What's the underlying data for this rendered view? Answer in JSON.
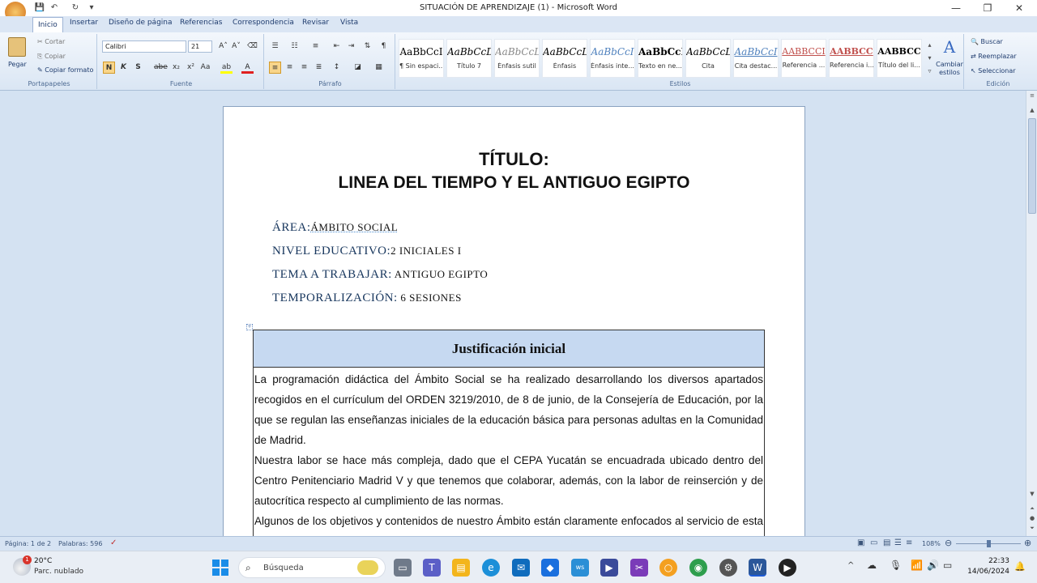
{
  "window": {
    "title": "SITUACIÓN DE APRENDIZAJE (1) - Microsoft Word",
    "minimize": "—",
    "restore": "❐",
    "close": "✕"
  },
  "tabs": [
    "Inicio",
    "Insertar",
    "Diseño de página",
    "Referencias",
    "Correspondencia",
    "Revisar",
    "Vista"
  ],
  "ribbon": {
    "clipboard": {
      "paste": "Pegar",
      "cut": "Cortar",
      "copy": "Copiar",
      "format_painter": "Copiar formato",
      "group": "Portapapeles"
    },
    "font": {
      "name": "Calibri",
      "size": "21",
      "group": "Fuente",
      "bold": "N",
      "italic": "K",
      "underline": "S"
    },
    "paragraph": {
      "group": "Párrafo"
    },
    "styles": {
      "group": "Estilos",
      "items": [
        {
          "sample": "AaBbCcI",
          "name": "¶ Sin espaci..."
        },
        {
          "sample": "AaBbCcD",
          "name": "Título 7"
        },
        {
          "sample": "AaBbCcL",
          "name": "Énfasis sutil"
        },
        {
          "sample": "AaBbCcL",
          "name": "Énfasis"
        },
        {
          "sample": "AaBbCcI",
          "name": "Énfasis inte..."
        },
        {
          "sample": "AaBbCcI",
          "name": "Texto en ne..."
        },
        {
          "sample": "AaBbCcL",
          "name": "Cita"
        },
        {
          "sample": "AaBbCcI",
          "name": "Cita destac..."
        },
        {
          "sample": "AABBCCI",
          "name": "Referencia ..."
        },
        {
          "sample": "AABBCC",
          "name": "Referencia i..."
        },
        {
          "sample": "AABBCC",
          "name": "Título del li..."
        }
      ],
      "change_styles": "Cambiar estilos"
    },
    "editing": {
      "find": "Buscar",
      "replace": "Reemplazar",
      "select": "Seleccionar",
      "group": "Edición"
    }
  },
  "document": {
    "title_line1": "TÍTULO:",
    "title_line2": "LINEA DEL TIEMPO Y EL ANTIGUO EGIPTO",
    "meta": [
      {
        "key": "ÁREA:",
        "value": "ÁMBITO SOCIAL"
      },
      {
        "key": "NIVEL EDUCATIVO:",
        "value": "2  INICIALES I"
      },
      {
        "key": "TEMA A TRABAJAR:",
        "value": " ANTIGUO EGIPTO"
      },
      {
        "key": "TEMPORALIZACIÓN:",
        "value": "  6 SESIONES"
      }
    ],
    "table_header": "Justificación inicial",
    "paragraphs": [
      "La programación didáctica del Ámbito Social se ha realizado desarrollando los diversos apartados recogidos en el currículum del ORDEN 3219/2010, de 8 de junio, de la Consejería de Educación, por la que se regulan las enseñanzas iniciales de la educación básica para personas adultas en la Comunidad de Madrid.",
      "Nuestra labor se hace más compleja, dado que el CEPA Yucatán se encuadrada ubicado dentro del Centro Penitenciario Madrid V y que tenemos que colaborar, además, con la labor de reinserción y de autocrítica respecto al cumplimiento de las normas.",
      "Algunos de los objetivos y contenidos de nuestro Ámbito están claramente enfocados al servicio de esta idea."
    ]
  },
  "status": {
    "page": "Página: 1 de 2",
    "words": "Palabras: 596",
    "zoom": "108%"
  },
  "taskbar": {
    "temp": "20°C",
    "weather": "Parc. nublado",
    "search_placeholder": "Búsqueda",
    "time": "22:33",
    "date": "14/06/2024",
    "badge": "1"
  }
}
